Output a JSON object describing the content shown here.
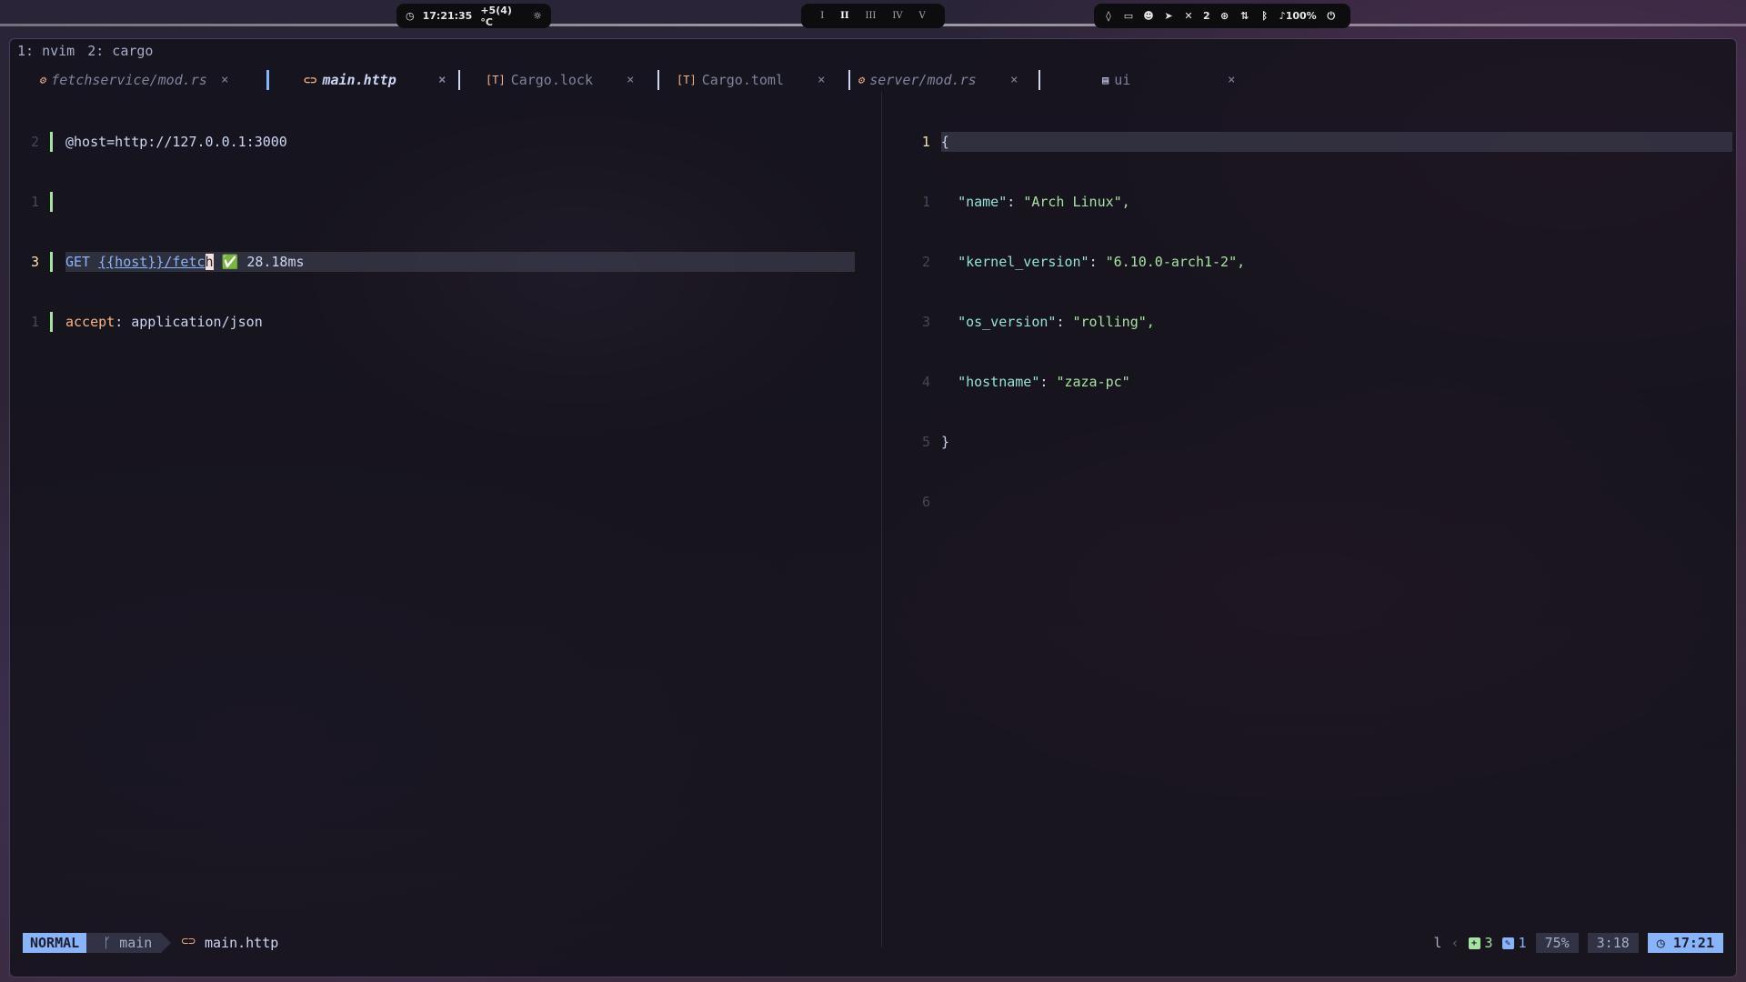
{
  "topbar": {
    "clock": "17:21:35",
    "weather": "+5(4) °C",
    "workspaces": [
      "I",
      "II",
      "III",
      "IV",
      "V"
    ],
    "active_workspace": "II",
    "notification_count": "2",
    "volume": "100%",
    "icons": [
      "drop-icon",
      "monitor-icon",
      "discord-icon",
      "telegram-icon",
      "bell-off-icon",
      "steam-icon",
      "network-icon",
      "bluetooth-icon",
      "volume-icon",
      "power-icon"
    ]
  },
  "tmux": {
    "windows": [
      "1: nvim",
      "2: cargo"
    ]
  },
  "tabs": [
    {
      "label": "fetchservice/mod.rs",
      "icon": "rust-icon",
      "active": false
    },
    {
      "label": "main.http",
      "icon": "link-icon",
      "active": true
    },
    {
      "label": "Cargo.lock",
      "icon": "toml-icon",
      "active": false
    },
    {
      "label": "Cargo.toml",
      "icon": "toml-icon",
      "active": false
    },
    {
      "label": "server/mod.rs",
      "icon": "rust-icon",
      "active": false
    },
    {
      "label": "ui",
      "icon": "file-icon",
      "active": false
    }
  ],
  "left_editor": {
    "line_numbers": [
      "2",
      "1",
      "3",
      "1"
    ],
    "host_line": "@host=http://127.0.0.1:3000",
    "request_method": "GET",
    "request_template": "{{host}}",
    "request_path": "/fetc",
    "request_cursor_char": "h",
    "request_status": "✅",
    "request_time": "28.18ms",
    "header_key": "accept",
    "header_value": "application/json"
  },
  "right_editor": {
    "line_numbers": [
      "1",
      "1",
      "2",
      "3",
      "4",
      "5",
      "6"
    ],
    "open_brace": "{",
    "close_brace": "}",
    "fields": [
      {
        "key": "\"name\"",
        "value": "\"Arch Linux\","
      },
      {
        "key": "\"kernel_version\"",
        "value": "\"6.10.0-arch1-2\","
      },
      {
        "key": "\"os_version\"",
        "value": "\"rolling\","
      },
      {
        "key": "\"hostname\"",
        "value": "\"zaza-pc\""
      }
    ]
  },
  "statusline": {
    "mode": "NORMAL",
    "branch": "main",
    "filename": "main.http",
    "lsp_indicator": "l",
    "added": "3",
    "modified": "1",
    "progress": "75%",
    "position": "3:18",
    "time": "17:21"
  },
  "colors": {
    "accent": "#89b4fa",
    "git_add": "#a6e3a1",
    "string": "#a6e3a1",
    "key": "#94e2d5"
  }
}
